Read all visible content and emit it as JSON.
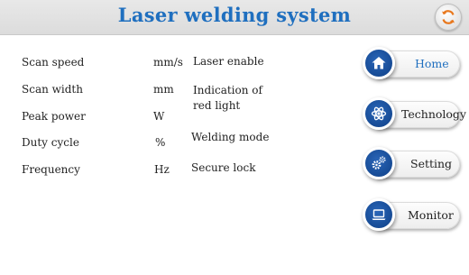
{
  "header": {
    "title": "Laser welding system",
    "refresh_icon": "refresh-icon",
    "title_color": "#1f6fbf"
  },
  "params": [
    {
      "label": "Scan speed",
      "unit": "mm/s"
    },
    {
      "label": "Scan width",
      "unit": "mm"
    },
    {
      "label": "Peak power",
      "unit": "W"
    },
    {
      "label": "Duty cycle",
      "unit": "%"
    },
    {
      "label": "Frequency",
      "unit": "Hz"
    }
  ],
  "switches": [
    {
      "label": "Laser enable"
    },
    {
      "label": "Indication of red light"
    },
    {
      "label": "Welding mode"
    },
    {
      "label": "Secure lock"
    }
  ],
  "nav": [
    {
      "label": "Home",
      "icon": "home-icon",
      "active": true
    },
    {
      "label": "Technology",
      "icon": "atom-icon",
      "active": false
    },
    {
      "label": "Setting",
      "icon": "gears-icon",
      "active": false
    },
    {
      "label": "Monitor",
      "icon": "laptop-icon",
      "active": false
    }
  ],
  "colors": {
    "nav_circle": "#1a4f9c",
    "active_text": "#1f6fbf"
  }
}
